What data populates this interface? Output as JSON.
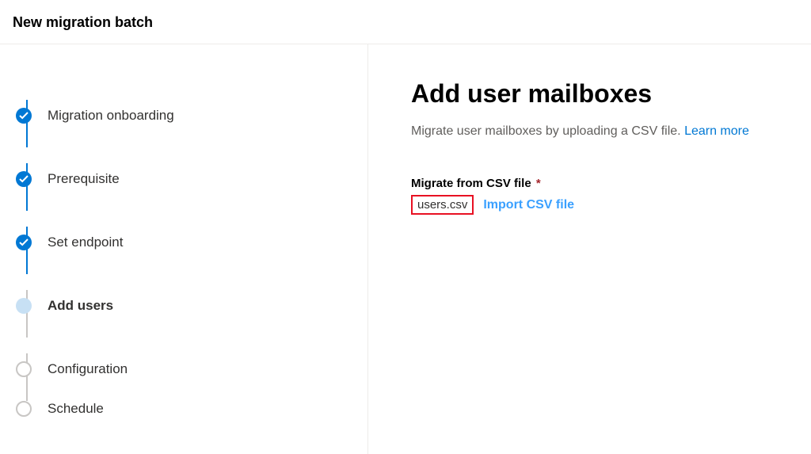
{
  "header": {
    "title": "New migration batch"
  },
  "steps": [
    {
      "label": "Migration onboarding",
      "state": "done"
    },
    {
      "label": "Prerequisite",
      "state": "done"
    },
    {
      "label": "Set endpoint",
      "state": "done"
    },
    {
      "label": "Add users",
      "state": "current"
    },
    {
      "label": "Configuration",
      "state": "todo"
    },
    {
      "label": "Schedule",
      "state": "todo"
    }
  ],
  "main": {
    "heading": "Add user mailboxes",
    "description_text": "Migrate user mailboxes by uploading a CSV file. ",
    "learn_more": "Learn more",
    "field_label": "Migrate from CSV file",
    "required_marker": "*",
    "filename": "users.csv",
    "import_label": "Import CSV file"
  }
}
